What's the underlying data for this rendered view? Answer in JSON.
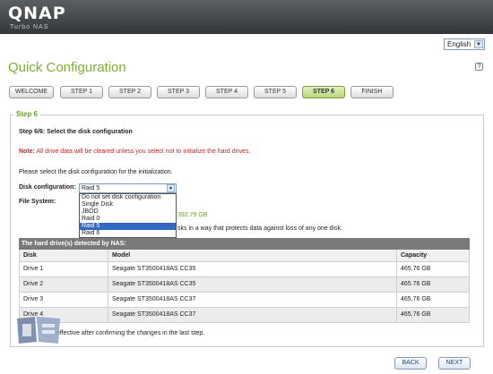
{
  "header": {
    "logo": "QNAP",
    "sublogo": "Turbo NAS"
  },
  "language": {
    "selected": "English"
  },
  "page_title": "Quick Configuration",
  "steps": [
    "WELCOME",
    "STEP 1",
    "STEP 2",
    "STEP 3",
    "STEP 4",
    "STEP 5",
    "STEP 6",
    "FINISH"
  ],
  "active_step": "STEP 6",
  "panel": {
    "title": "Step 6",
    "heading": "Step 6/6: Select the disk configuration",
    "note_label": "Note:",
    "note_text": "All drive data will be cleared unless you select not to initialize the hard drives.",
    "instruction": "Please select the disk configuration for the initialization.",
    "disk_config_label": "Disk configuration:",
    "disk_config_value": "Raid 5",
    "filesystem_label": "File System:",
    "capacity_partial": "392.79 GB",
    "desc_partial": "sks in a way that protects data against loss of any one disk.",
    "footer_partial": "effective after confirming the changes in the last step."
  },
  "dropdown_options": [
    "Do not set disk configuration",
    "Single Disk",
    "JBOD",
    "Raid 0",
    "Raid 5",
    "Raid 6"
  ],
  "dropdown_selected_index": 4,
  "table": {
    "title": "The hard drive(s) detected by NAS:",
    "headers": [
      "Disk",
      "Model",
      "Capacity"
    ],
    "rows": [
      [
        "Drive 1",
        "Seagate ST3500418AS CC35",
        "465.76 GB"
      ],
      [
        "Drive 2",
        "Seagate ST3500418AS CC35",
        "465.76 GB"
      ],
      [
        "Drive 3",
        "Seagate ST3500418AS CC37",
        "465.76 GB"
      ],
      [
        "Drive 4",
        "Seagate ST3500418AS CC37",
        "465.76 GB"
      ]
    ]
  },
  "buttons": {
    "back": "BACK",
    "next": "NEXT"
  },
  "colors": {
    "accent_green": "#7daf2f",
    "selection_blue": "#316ac5",
    "note_red": "#cc2222"
  }
}
